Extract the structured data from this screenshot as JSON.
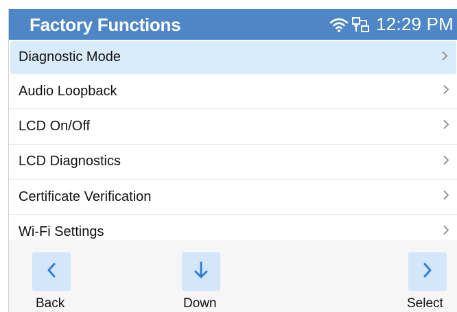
{
  "header": {
    "title": "Factory Functions",
    "time": "12:29 PM",
    "color": "#4f87c6"
  },
  "menu": {
    "items": [
      {
        "label": "Diagnostic Mode",
        "selected": true
      },
      {
        "label": "Audio Loopback"
      },
      {
        "label": "LCD On/Off"
      },
      {
        "label": "LCD Diagnostics"
      },
      {
        "label": "Certificate Verification"
      },
      {
        "label": "Wi-Fi Settings"
      }
    ],
    "selected_color": "#d9ecfb"
  },
  "softkeys": {
    "back": {
      "label": "Back",
      "icon": "chevron-left-icon"
    },
    "down": {
      "label": "Down",
      "icon": "arrow-down-icon"
    },
    "select": {
      "label": "Select",
      "icon": "chevron-right-icon"
    },
    "accent": "#2f7fd8"
  }
}
